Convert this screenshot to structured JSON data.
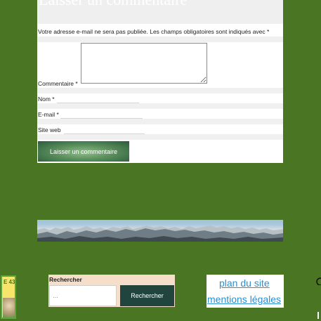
{
  "comment_form": {
    "heading": "Laisser un commentaire",
    "notes": "Votre adresse e-mail ne sera pas publiée. Les champs obligatoires sont indiqués avec *",
    "comment_label": "Commentaire *",
    "name_label": "Nom *",
    "email_label": "E-mail *",
    "website_label": "Site web",
    "submit_label": "Laisser un commentaire"
  },
  "search": {
    "title": "Rechercher",
    "placeholder": "…",
    "button_label": "Rechercher"
  },
  "footer_links": {
    "sitemap": "plan du site",
    "legal": "mentions légales"
  },
  "side_badge": {
    "text": "E 43"
  },
  "colors": {
    "page_background": "#4a7523",
    "search_button": "#22443e",
    "link": "#2a8fd0"
  }
}
